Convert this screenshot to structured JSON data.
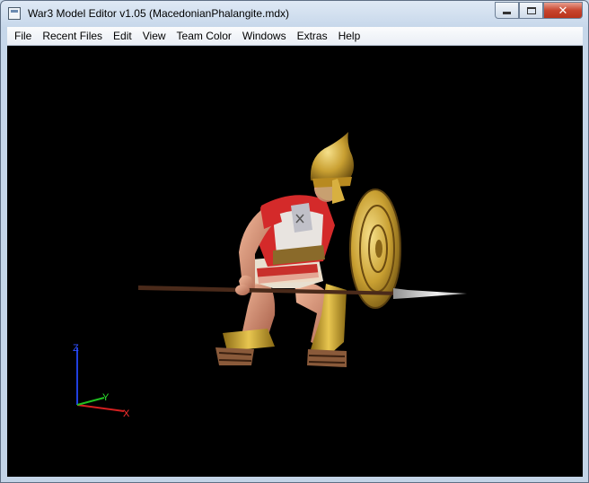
{
  "window": {
    "title": "War3 Model Editor v1.05 (MacedonianPhalangite.mdx)",
    "minimize_glyph": "minimize-icon",
    "maximize_glyph": "maximize-icon",
    "close_glyph": "✕"
  },
  "menu": {
    "items": [
      "File",
      "Recent Files",
      "Edit",
      "View",
      "Team Color",
      "Windows",
      "Extras",
      "Help"
    ]
  },
  "viewport": {
    "background": "#000000",
    "axes": {
      "x": "X",
      "y": "Y",
      "z": "Z"
    },
    "axis_colors": {
      "x": "#d42020",
      "y": "#20c020",
      "z": "#2040e0"
    }
  }
}
